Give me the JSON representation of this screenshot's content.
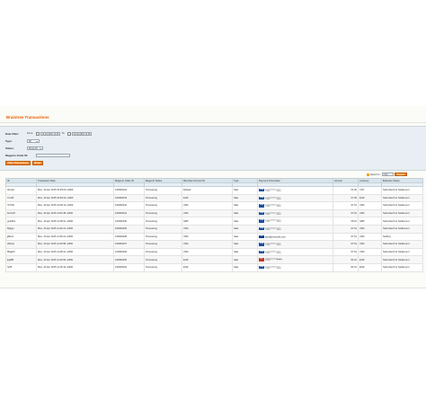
{
  "page": {
    "title": "Braintree Transactions"
  },
  "filter": {
    "date_label": "Date Filter:",
    "from_label": "From:",
    "from_value": "10-04-2015 14:36",
    "to_label": "To:",
    "to_value": "20-04-2015 14:36",
    "type_label": "Type:",
    "type_value": "All",
    "status_label": "Status:",
    "status_value": "Show All",
    "order_label": "Magento Order ID:",
    "order_value": "",
    "filter_button": "Filter Transactions",
    "reset_button": "Reset"
  },
  "export": {
    "label": "Export to:",
    "format": "CSV",
    "button": "Export"
  },
  "table": {
    "columns": [
      "ID",
      "Transaction Date",
      "Magento Order ID",
      "Magento Status",
      "Merchant Account ID",
      "Type",
      "Payment Information",
      "Amount",
      "Currency",
      "Braintree Status"
    ],
    "rows": [
      {
        "id": "4fcyhjc",
        "date": "Mon, 20 Apr 2015 15:25:03 +0000",
        "order": "100000244",
        "mstatus": "Processing",
        "merchant": "Default",
        "type": "Sale",
        "card": "VISA",
        "payment": "4111*******1111",
        "amount": "51.00",
        "currency": "CNY",
        "bstatus": "Submitted For Settlement"
      },
      {
        "id": "7nrxf6",
        "date": "Mon, 20 Apr 2015 15:20:22 +0000",
        "order": "100000243",
        "mstatus": "Processing",
        "merchant": "EUR",
        "type": "Sale",
        "card": "VISA",
        "payment": "4111*******1111",
        "amount": "67.00",
        "currency": "EUR",
        "bstatus": "Submitted For Settlement"
      },
      {
        "id": "7k7r6b",
        "date": "Mon, 20 Apr 2015 12:08:12 +0000",
        "order": "100000242",
        "mstatus": "Processing",
        "merchant": "USD",
        "type": "Sale",
        "card": "VISA",
        "payment": "4111*******1111",
        "amount": "97.61",
        "currency": "USD",
        "bstatus": "Submitted For Settlement"
      },
      {
        "id": "bncrtn8",
        "date": "Mon, 20 Apr 2015 11:52:48 +0000",
        "order": "100000241",
        "mstatus": "Processing",
        "merchant": "USD",
        "type": "Sale",
        "card": "VISA",
        "payment": "4111*******1111",
        "amount": "97.61",
        "currency": "USD",
        "bstatus": "Submitted For Settlement"
      },
      {
        "id": "gn3rkbs",
        "date": "Mon, 20 Apr 2015 11:48:31 +0000",
        "order": "100000240",
        "mstatus": "Processing",
        "merchant": "GBP",
        "type": "Sale",
        "card": "VISA",
        "payment": "4111*******1111",
        "amount": "65.10",
        "currency": "GBP",
        "bstatus": "Submitted For Settlement"
      },
      {
        "id": "6fgkgv",
        "date": "Mon, 20 Apr 2015 11:42:13 +0000",
        "order": "100000239",
        "mstatus": "Processing",
        "merchant": "USD",
        "type": "Sale",
        "card": "VISA",
        "payment": "4111*******1111",
        "amount": "97.61",
        "currency": "USD",
        "bstatus": "Submitted For Settlement"
      },
      {
        "id": "jj8kmz",
        "date": "Mon, 20 Apr 2015 11:39:14 +0000",
        "order": "100000238",
        "mstatus": "Processing",
        "merchant": "USD",
        "type": "Sale",
        "card": "PP",
        "payment": "jdoe@example.com",
        "amount": "97.61",
        "currency": "USD",
        "bstatus": "Settling"
      },
      {
        "id": "3dhy2j",
        "date": "Mon, 20 Apr 2015 11:34:58 +0000",
        "order": "100000237",
        "mstatus": "Processing",
        "merchant": "USD",
        "type": "Sale",
        "card": "VISA",
        "payment": "4111*******1111",
        "amount": "97.61",
        "currency": "USD",
        "bstatus": "Submitted For Settlement"
      },
      {
        "id": "8t6gjh6",
        "date": "Mon, 20 Apr 2015 11:28:41 +0000",
        "order": "100000236",
        "mstatus": "Processing",
        "merchant": "USD",
        "type": "Sale",
        "card": "VISA",
        "payment": "4111*******1111",
        "amount": "97.61",
        "currency": "USD",
        "bstatus": "Submitted For Settlement"
      },
      {
        "id": "jkg8f8",
        "date": "Mon, 20 Apr 2015 11:20:09 +0000",
        "order": "100000235",
        "mstatus": "Processing",
        "merchant": "EUR",
        "type": "Sale",
        "card": "MC",
        "payment": "5555*******4444",
        "amount": "81.10",
        "currency": "EUR",
        "bstatus": "Submitted For Settlement"
      },
      {
        "id": "hrtf5",
        "date": "Mon, 20 Apr 2015 11:15:44 +0000",
        "order": "100000234",
        "mstatus": "Processing",
        "merchant": "EUR",
        "type": "Sale",
        "card": "VISA",
        "payment": "4111*******1111",
        "amount": "81.10",
        "currency": "EUR",
        "bstatus": "Submitted For Settlement"
      }
    ]
  },
  "colors": {
    "accent": "#eb5e00",
    "button": "#f2831e",
    "filter_bg": "#e8eef3",
    "header_bg": "#d9e5ec"
  }
}
